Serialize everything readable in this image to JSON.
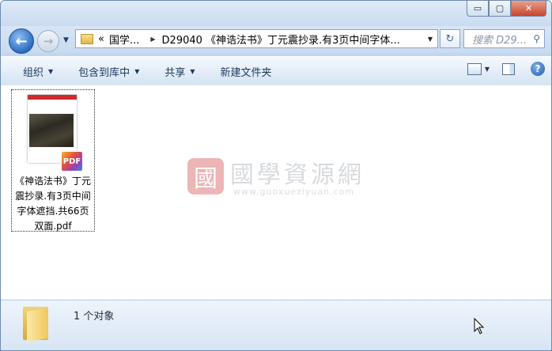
{
  "titlebar": {
    "minimize_label": "▭",
    "maximize_label": "▢",
    "close_label": "✕"
  },
  "nav": {
    "back_glyph": "←",
    "forward_glyph": "→",
    "history_glyph": "▼",
    "breadcrumb_prefix": "«",
    "breadcrumb": [
      "国学...",
      "D29040 《神诰法书》丁元震抄录.有3页中间字体..."
    ],
    "search_placeholder": "搜索 D29...",
    "refresh_glyph": "↻",
    "search_icon": "magnifier-icon"
  },
  "toolbar": {
    "organize": "组织",
    "include_in_library": "包含到库中",
    "share": "共享",
    "new_folder": "新建文件夹",
    "help_glyph": "?"
  },
  "files": [
    {
      "name": "《神诰法书》丁元震抄录.有3页中间字体遮挡.共66页双面.pdf",
      "badge": "PDF"
    }
  ],
  "watermark": {
    "seal": "國",
    "title": "國學資源網",
    "url": "www.guoxueziyuan.com"
  },
  "details": {
    "count_text": "1 个对象"
  }
}
